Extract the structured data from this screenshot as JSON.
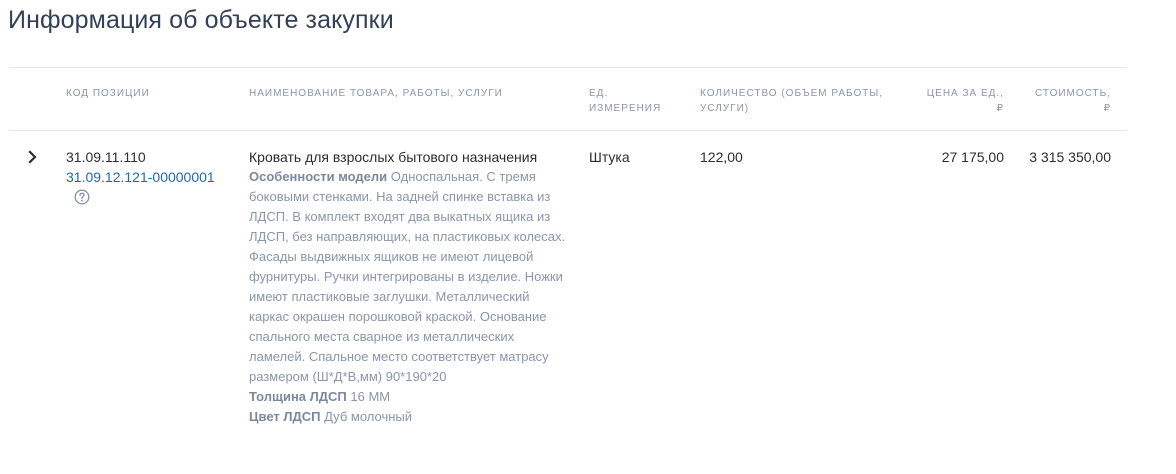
{
  "page": {
    "title": "Информация об объекте закупки"
  },
  "table": {
    "headers": {
      "code": "КОД ПОЗИЦИИ",
      "name": "НАИМЕНОВАНИЕ ТОВАРА, РАБОТЫ, УСЛУГИ",
      "unit_line1": "ЕД.",
      "unit_line2": "ИЗМЕРЕНИЯ",
      "qty_line1": "КОЛИЧЕСТВО (ОБЪЕМ РАБОТЫ,",
      "qty_line2": "УСЛУГИ)",
      "price_line1": "ЦЕНА ЗА ЕД.,",
      "price_line2": "₽",
      "cost_line1": "СТОИМОСТЬ,",
      "cost_line2": "₽"
    },
    "rows": [
      {
        "code_primary": "31.09.11.110",
        "code_secondary": "31.09.12.121-00000001",
        "name": "Кровать для взрослых бытового назначения",
        "features": [
          {
            "label": "Особенности модели",
            "value": "Односпальная. С тремя боковыми стенками. На задней спинке вставка из ЛДСП. В комплект входят два выкатных ящика из ЛДСП, без направляющих, на пластиковых колесах. Фасады выдвижных ящиков не имеют лицевой фурнитуры. Ручки интегрированы в изделие. Ножки имеют пластиковые заглушки. Металлический каркас окрашен порошковой краской. Основание спального места сварное из металлических ламелей. Спальное место соответствует матрасу размером (Ш*Д*В,мм) 90*190*20"
          },
          {
            "label": "Толщина ЛДСП",
            "value": "16 ММ"
          },
          {
            "label": "Цвет ЛДСП",
            "value": "Дуб молочный"
          }
        ],
        "unit": "Штука",
        "quantity": "122,00",
        "price": "27 175,00",
        "cost": "3 315 350,00"
      }
    ]
  },
  "icons": {
    "expand": "chevron-right-icon",
    "help": "question-circle-icon"
  },
  "colors": {
    "title": "#334059",
    "header_text": "#8a96a9",
    "link": "#1f68b5",
    "muted_text": "#8a96a9",
    "divider": "#e4e7eb"
  }
}
